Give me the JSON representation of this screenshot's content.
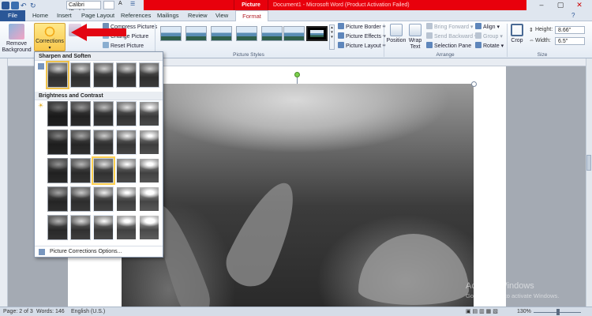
{
  "titlebar": {
    "font_name": "Calibri (Body)",
    "context_tab": "Picture Tools",
    "doc_title": "Document1 - Microsoft Word (Product Activation Failed)"
  },
  "tabs": [
    "File",
    "Home",
    "Insert",
    "Page Layout",
    "References",
    "Mailings",
    "Review",
    "View",
    "Format"
  ],
  "ribbon": {
    "remove_background": "Remove Background",
    "corrections": "Corrections",
    "compress": "Compress Pictures",
    "change_picture": "Change Picture",
    "reset_picture": "Reset Picture",
    "picture_styles_label": "Picture Styles",
    "picture_border": "Picture Border",
    "picture_effects": "Picture Effects",
    "picture_layout": "Picture Layout",
    "position": "Position",
    "wrap_text": "Wrap Text",
    "bring_forward": "Bring Forward",
    "send_backward": "Send Backward",
    "selection_pane": "Selection Pane",
    "align": "Align",
    "group": "Group",
    "rotate": "Rotate",
    "arrange_label": "Arrange",
    "crop": "Crop",
    "height_label": "Height:",
    "height_value": "8.66\"",
    "width_label": "Width:",
    "width_value": "6.5\"",
    "size_label": "Size"
  },
  "gallery": {
    "section1": "Sharpen and Soften",
    "section2": "Brightness and Contrast",
    "footer": "Picture Corrections Options..."
  },
  "document": {
    "watermark_title": "Activate Windows",
    "watermark_sub": "Go to Settings to activate Windows."
  },
  "status": {
    "page": "Page: 2 of 3",
    "words": "Words: 146",
    "language": "English (U.S.)",
    "zoom": "130%"
  },
  "colors": {
    "accent_red": "#e8000c",
    "file_tab": "#2b5797",
    "highlight": "#f0c24b"
  }
}
